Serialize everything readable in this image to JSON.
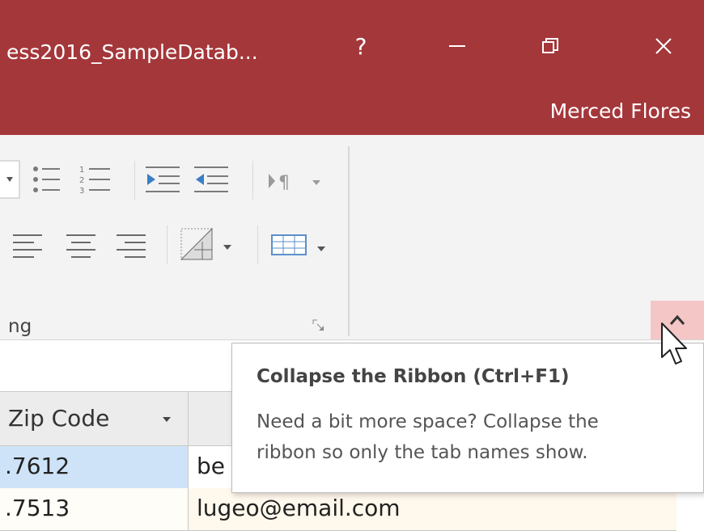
{
  "window": {
    "title": "ess2016_SampleDatab...",
    "help_label": "?",
    "user_name": "Merced Flores",
    "accent_color": "#a4373a"
  },
  "ribbon": {
    "group_label": "ng",
    "collapse_highlight_color": "#f5c6c6",
    "icons": [
      "bullets-icon",
      "numbering-icon",
      "increase-indent-icon",
      "decrease-indent-icon",
      "ltr-direction-icon",
      "align-left-icon",
      "align-center-icon",
      "align-right-icon",
      "alternate-row-color-icon",
      "gridlines-icon",
      "dialog-launcher-icon",
      "collapse-ribbon-icon"
    ]
  },
  "table": {
    "columns": [
      {
        "label": "Zip Code"
      }
    ],
    "rows": [
      {
        "zip": ".7612",
        "email": "be"
      },
      {
        "zip": ".7513",
        "email": "lugeo@email.com"
      }
    ],
    "selected_row_color": "#cfe3f8"
  },
  "tooltip": {
    "title": "Collapse the Ribbon (Ctrl+F1)",
    "line1": "Need a bit more space? Collapse the",
    "line2": "ribbon so only the tab names show."
  }
}
